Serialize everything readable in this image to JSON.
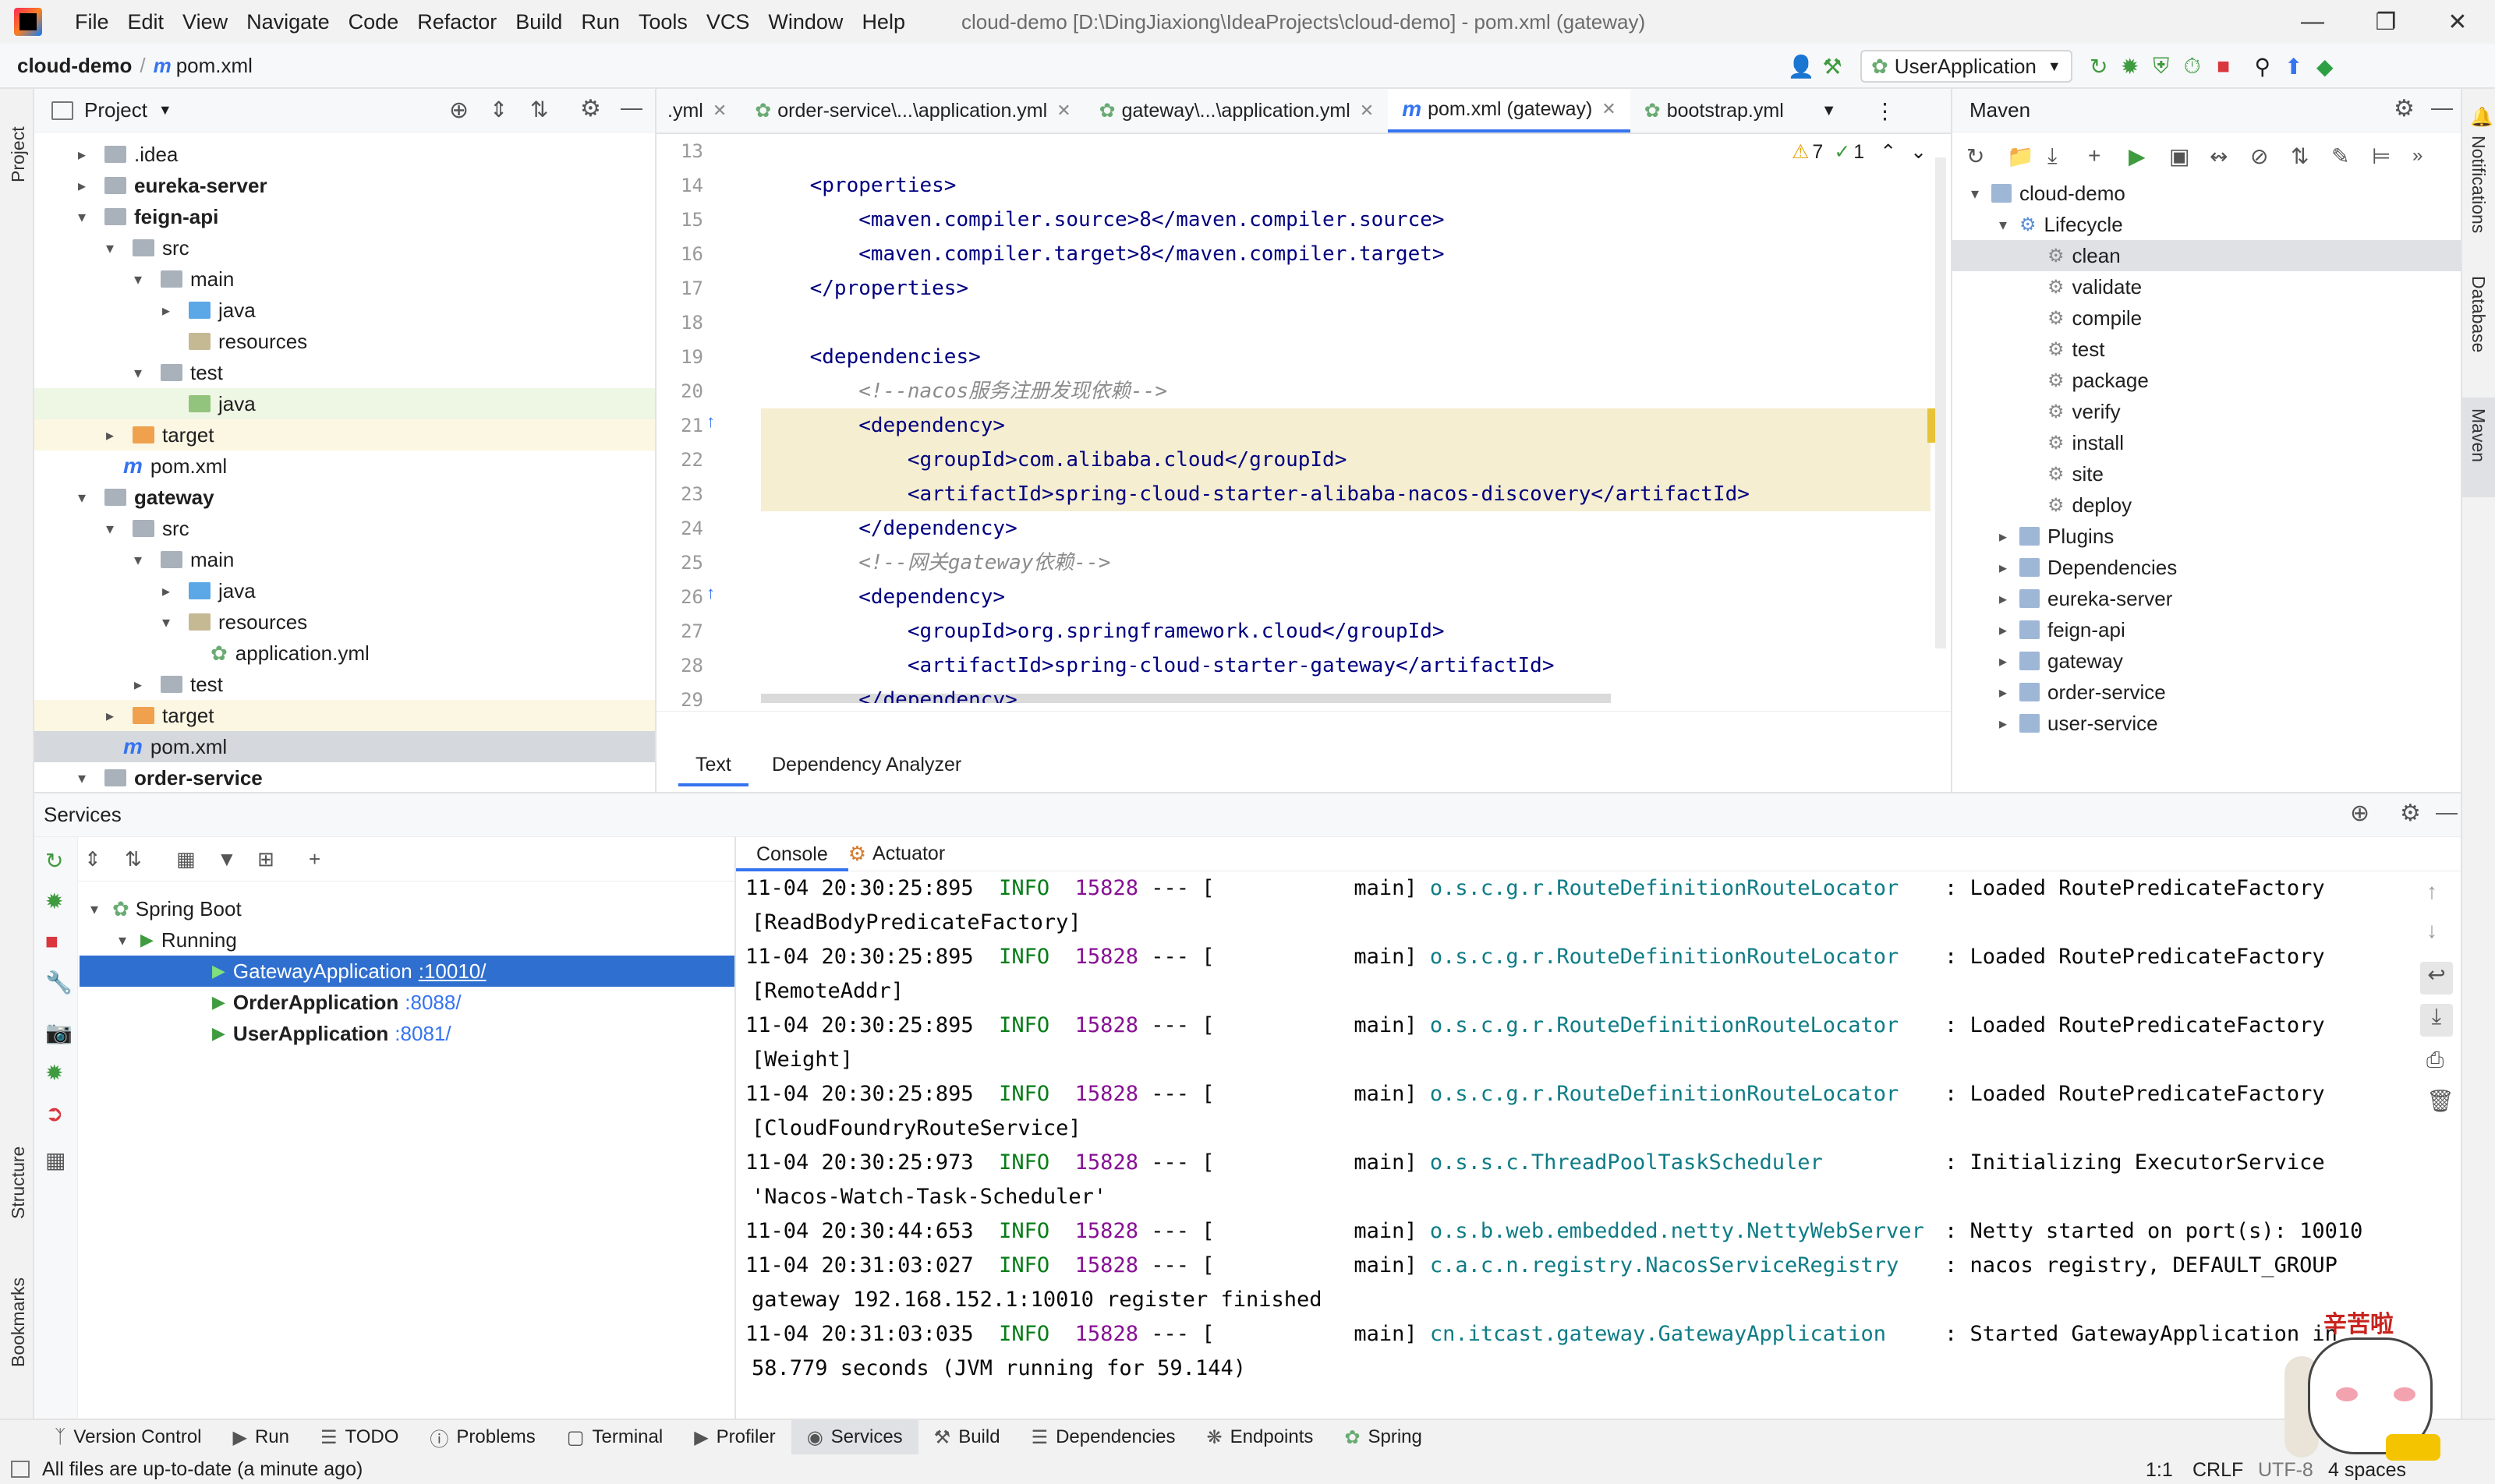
{
  "window": {
    "title": "cloud-demo [D:\\DingJiaxiong\\IdeaProjects\\cloud-demo] - pom.xml (gateway)",
    "menu": [
      "File",
      "Edit",
      "View",
      "Navigate",
      "Code",
      "Refactor",
      "Build",
      "Run",
      "Tools",
      "VCS",
      "Window",
      "Help"
    ]
  },
  "nav": {
    "project": "cloud-demo",
    "file": "pom.xml",
    "run_config": "UserApplication"
  },
  "left_stripe": {
    "project": "Project",
    "structure": "Structure",
    "bookmarks": "Bookmarks"
  },
  "right_stripe": {
    "notifications": "Notifications",
    "database": "Database",
    "maven": "Maven"
  },
  "project_panel": {
    "title": "Project",
    "tree": [
      {
        "label": ".idea"
      },
      {
        "label": "eureka-server"
      },
      {
        "label": "feign-api"
      },
      {
        "label": "src"
      },
      {
        "label": "main"
      },
      {
        "label": "java"
      },
      {
        "label": "resources"
      },
      {
        "label": "test"
      },
      {
        "label": "java"
      },
      {
        "label": "target"
      },
      {
        "label": "pom.xml"
      },
      {
        "label": "gateway"
      },
      {
        "label": "src"
      },
      {
        "label": "main"
      },
      {
        "label": "java"
      },
      {
        "label": "resources"
      },
      {
        "label": "application.yml"
      },
      {
        "label": "test"
      },
      {
        "label": "target"
      },
      {
        "label": "pom.xml"
      },
      {
        "label": "order-service"
      }
    ]
  },
  "editor": {
    "tabs": [
      {
        "label": ".yml"
      },
      {
        "label": "order-service\\...\\application.yml"
      },
      {
        "label": "gateway\\...\\application.yml"
      },
      {
        "label": "pom.xml (gateway)"
      },
      {
        "label": "bootstrap.yml"
      }
    ],
    "inspections": {
      "warnings": "7",
      "ok": "1"
    },
    "lines": [
      {
        "n": "13",
        "text": ""
      },
      {
        "n": "14",
        "text": "    <properties>"
      },
      {
        "n": "15",
        "text": "        <maven.compiler.source>8</maven.compiler.source>"
      },
      {
        "n": "16",
        "text": "        <maven.compiler.target>8</maven.compiler.target>"
      },
      {
        "n": "17",
        "text": "    </properties>"
      },
      {
        "n": "18",
        "text": ""
      },
      {
        "n": "19",
        "text": "    <dependencies>"
      },
      {
        "n": "20",
        "text": "        <!--nacos服务注册发现依赖-->"
      },
      {
        "n": "21",
        "text": "        <dependency>"
      },
      {
        "n": "22",
        "text": "            <groupId>com.alibaba.cloud</groupId>"
      },
      {
        "n": "23",
        "text": "            <artifactId>spring-cloud-starter-alibaba-nacos-discovery</artifactId>"
      },
      {
        "n": "24",
        "text": "        </dependency>"
      },
      {
        "n": "25",
        "text": "        <!--网关gateway依赖-->"
      },
      {
        "n": "26",
        "text": "        <dependency>"
      },
      {
        "n": "27",
        "text": "            <groupId>org.springframework.cloud</groupId>"
      },
      {
        "n": "28",
        "text": "            <artifactId>spring-cloud-starter-gateway</artifactId>"
      },
      {
        "n": "29",
        "text": "        </dependency>"
      }
    ],
    "bottom_tabs": [
      "Text",
      "Dependency Analyzer"
    ]
  },
  "maven": {
    "title": "Maven",
    "root": "cloud-demo",
    "lifecycle": "Lifecycle",
    "goals": [
      "clean",
      "validate",
      "compile",
      "test",
      "package",
      "verify",
      "install",
      "site",
      "deploy"
    ],
    "nodes": [
      "Plugins",
      "Dependencies",
      "eureka-server",
      "feign-api",
      "gateway",
      "order-service",
      "user-service"
    ]
  },
  "services": {
    "title": "Services",
    "tree": {
      "spring_boot": "Spring Boot",
      "running": "Running",
      "apps": [
        {
          "name": "GatewayApplication",
          "port": ":10010/"
        },
        {
          "name": "OrderApplication",
          "port": ":8088/"
        },
        {
          "name": "UserApplication",
          "port": ":8081/"
        }
      ]
    },
    "console_tabs": [
      "Console",
      "Actuator"
    ],
    "log": [
      {
        "ts": "11-04 20:30:25:895",
        "level": "INFO",
        "pid": "15828",
        "sep": "--- [",
        "thread": "main]",
        "logger": "o.s.c.g.r.RouteDefinitionRouteLocator",
        "msg": ": Loaded RoutePredicateFactory",
        "cont": "[ReadBodyPredicateFactory]"
      },
      {
        "ts": "11-04 20:30:25:895",
        "level": "INFO",
        "pid": "15828",
        "sep": "--- [",
        "thread": "main]",
        "logger": "o.s.c.g.r.RouteDefinitionRouteLocator",
        "msg": ": Loaded RoutePredicateFactory",
        "cont": "[RemoteAddr]"
      },
      {
        "ts": "11-04 20:30:25:895",
        "level": "INFO",
        "pid": "15828",
        "sep": "--- [",
        "thread": "main]",
        "logger": "o.s.c.g.r.RouteDefinitionRouteLocator",
        "msg": ": Loaded RoutePredicateFactory",
        "cont": "[Weight]"
      },
      {
        "ts": "11-04 20:30:25:895",
        "level": "INFO",
        "pid": "15828",
        "sep": "--- [",
        "thread": "main]",
        "logger": "o.s.c.g.r.RouteDefinitionRouteLocator",
        "msg": ": Loaded RoutePredicateFactory",
        "cont": "[CloudFoundryRouteService]"
      },
      {
        "ts": "11-04 20:30:25:973",
        "level": "INFO",
        "pid": "15828",
        "sep": "--- [",
        "thread": "main]",
        "logger": "o.s.s.c.ThreadPoolTaskScheduler",
        "msg": ": Initializing ExecutorService",
        "cont": "'Nacos-Watch-Task-Scheduler'"
      },
      {
        "ts": "11-04 20:30:44:653",
        "level": "INFO",
        "pid": "15828",
        "sep": "--- [",
        "thread": "main]",
        "logger": "o.s.b.web.embedded.netty.NettyWebServer",
        "msg": ": Netty started on port(s): 10010",
        "cont": ""
      },
      {
        "ts": "11-04 20:31:03:027",
        "level": "INFO",
        "pid": "15828",
        "sep": "--- [",
        "thread": "main]",
        "logger": "c.a.c.n.registry.NacosServiceRegistry",
        "msg": ": nacos registry, DEFAULT_GROUP",
        "cont": "gateway 192.168.152.1:10010 register finished"
      },
      {
        "ts": "11-04 20:31:03:035",
        "level": "INFO",
        "pid": "15828",
        "sep": "--- [",
        "thread": "main]",
        "logger": "cn.itcast.gateway.GatewayApplication",
        "msg": ": Started GatewayApplication in",
        "cont": "58.779 seconds (JVM running for 59.144)"
      }
    ]
  },
  "bottom_tools": [
    "Version Control",
    "Run",
    "TODO",
    "Problems",
    "Terminal",
    "Profiler",
    "Services",
    "Build",
    "Dependencies",
    "Endpoints",
    "Spring"
  ],
  "status": {
    "message": "All files are up-to-date (a minute ago)",
    "position": "1:1",
    "line_sep": "CRLF",
    "encoding": "UTF-8",
    "indent": "4 spaces"
  },
  "sticker": {
    "text": "辛苦啦"
  },
  "colors": {
    "accent": "#3574f0",
    "selection": "#2f6fd0",
    "highlight": "#f5eed0",
    "info": "#067d17",
    "pid": "#871094",
    "logger": "#0e7c86"
  }
}
